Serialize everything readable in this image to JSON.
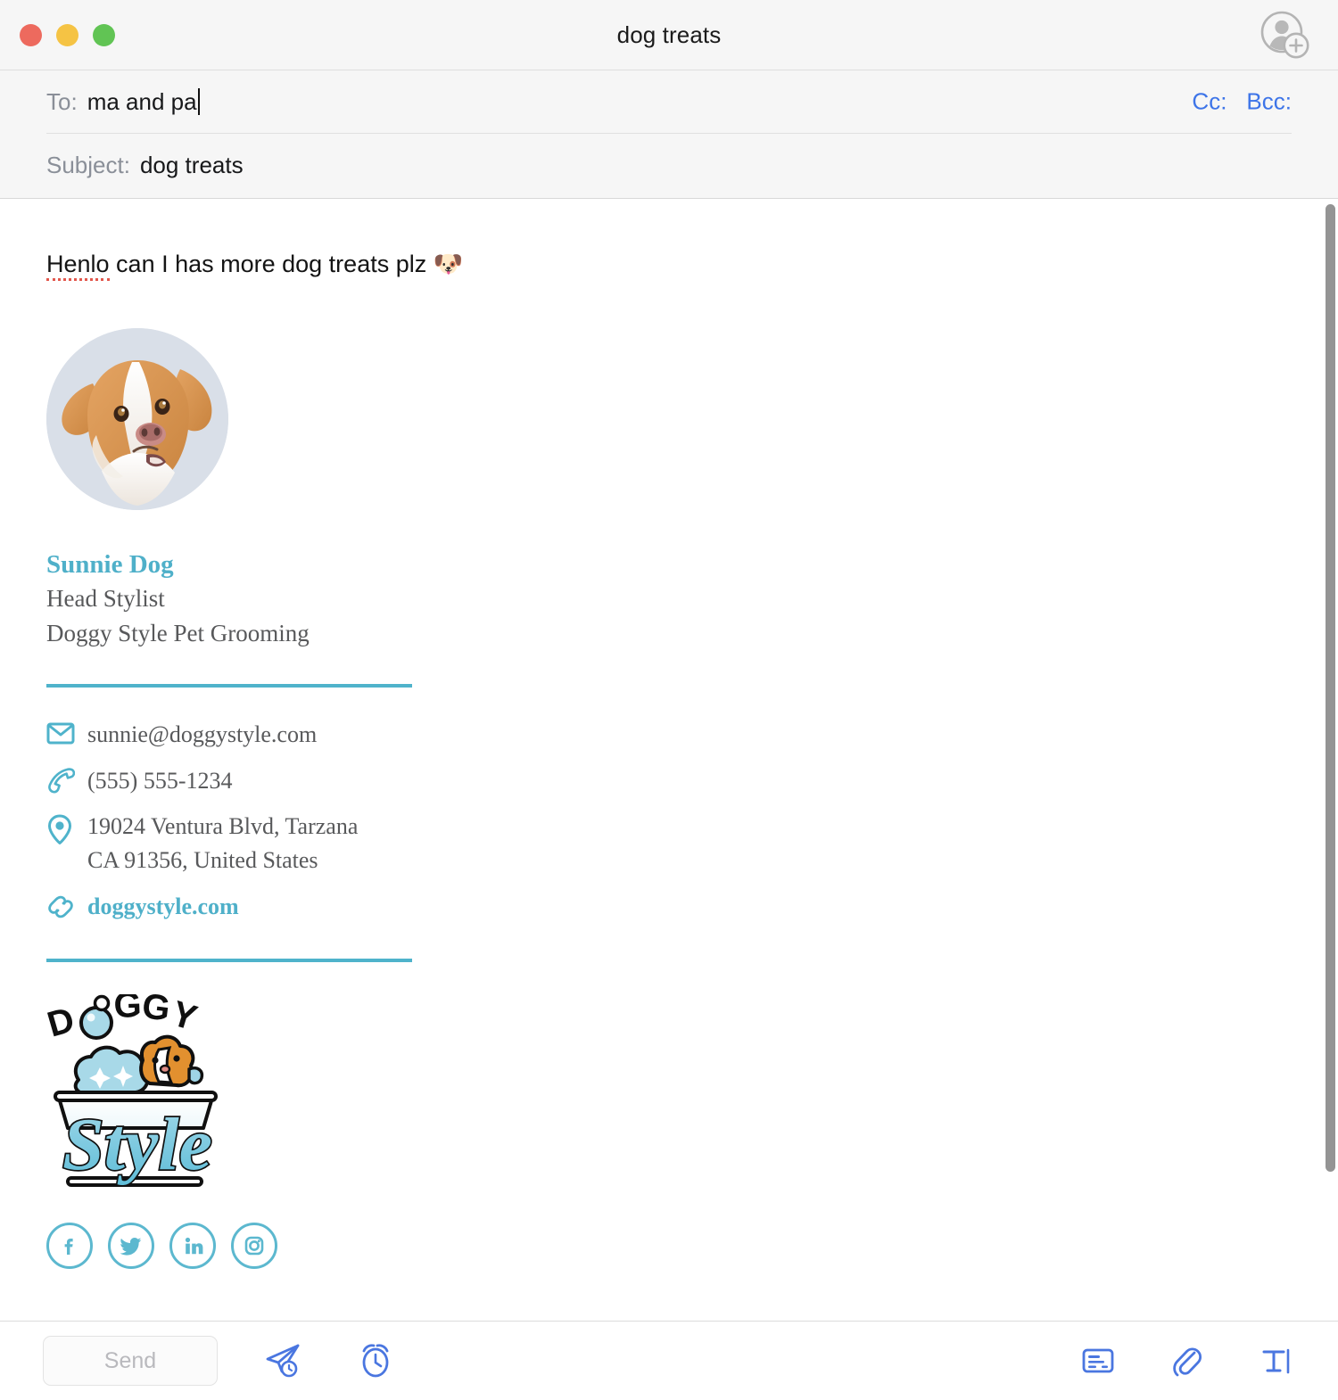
{
  "window": {
    "title": "dog treats",
    "traffic_lights": [
      {
        "name": "close",
        "color": "#ed6a5e"
      },
      {
        "name": "minimize",
        "color": "#f5c344"
      },
      {
        "name": "maximize",
        "color": "#61c454"
      }
    ],
    "add_contact_icon": "add-contact-icon"
  },
  "fields": {
    "to_label": "To:",
    "to_value": "ma and pa",
    "to_placeholder": "",
    "cc_label": "Cc:",
    "bcc_label": "Bcc:",
    "subject_label": "Subject:",
    "subject_value": "dog treats",
    "subject_placeholder": "Subject"
  },
  "body": {
    "greeting_misspelled": "Henlo",
    "greeting_rest": " can I has more dog treats plz ",
    "greeting_emoji": "🐶"
  },
  "signature": {
    "avatar_alt": "dog-photo",
    "name": "Sunnie Dog",
    "role": "Head Stylist",
    "company": "Doggy Style Pet Grooming",
    "accent_color": "#4fb0c9",
    "divider_color": "#4fb3cb",
    "contacts": [
      {
        "icon": "envelope-icon",
        "text": "sunnie@doggystyle.com",
        "is_link": false
      },
      {
        "icon": "phone-icon",
        "text": "(555) 555-1234",
        "is_link": false
      },
      {
        "icon": "location-pin-icon",
        "text": "19024 Ventura Blvd, Tarzana\nCA 91356, United States",
        "is_link": false
      },
      {
        "icon": "link-icon",
        "text": "doggystyle.com",
        "is_link": true
      }
    ],
    "logo": {
      "name": "doggy-style-logo",
      "word_top": "DOGGY",
      "word_bottom": "Style"
    },
    "social": [
      {
        "name": "facebook-icon",
        "label": "Facebook"
      },
      {
        "name": "twitter-icon",
        "label": "Twitter"
      },
      {
        "name": "linkedin-icon",
        "label": "LinkedIn"
      },
      {
        "name": "instagram-icon",
        "label": "Instagram"
      }
    ]
  },
  "toolbar": {
    "send_label": "Send",
    "send_later_icon": "send-later-icon",
    "remind_icon": "alarm-clock-icon",
    "signature_icon": "signature-card-icon",
    "attach_icon": "paperclip-icon",
    "format_icon": "text-format-icon",
    "accent_color": "#4a76e0"
  }
}
